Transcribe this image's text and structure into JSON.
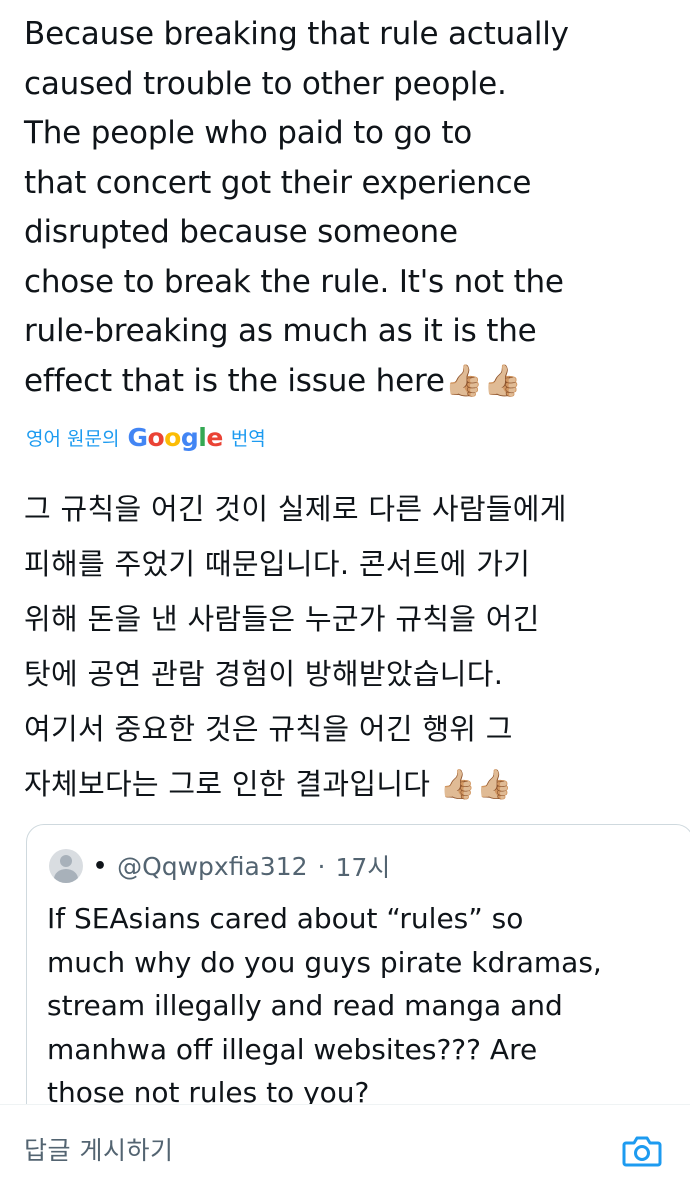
{
  "post": {
    "text_lines": [
      "Because breaking that rule actually",
      "caused trouble to other people.",
      "The people who paid to go to",
      "that concert got their experience",
      "disrupted because someone",
      "chose to break the rule. It's not the",
      "rule-breaking as much as it is the",
      "effect that is the issue here👍🏼👍🏼"
    ],
    "translation": {
      "prefix": "영어 원문의",
      "google": "Google",
      "suffix": "번역"
    },
    "translated_lines": [
      "그 규칙을 어긴 것이 실제로 다른 사람들에게",
      "피해를 주었기 때문입니다. 콘서트에 가기",
      "위해 돈을 낸 사람들은 누군가 규칙을 어긴",
      "탓에 공연 관람 경험이 방해받았습니다.",
      "여기서 중요한 것은 규칙을 어긴 행위 그",
      "자체보다는 그로 인한 결과입니다 👍🏼👍🏼"
    ]
  },
  "quote": {
    "dot": "•",
    "handle": "@Qqwpxfia312",
    "separator": "·",
    "time": "17시",
    "text_lines": [
      "If SEAsians cared about “rules” so",
      "much why do you guys pirate kdramas,",
      "stream illegally and read manga and",
      "manhwa off illegal websites??? Are",
      "those not rules to you?"
    ]
  },
  "reply": {
    "placeholder": "답글 게시하기",
    "icon": "camera-icon",
    "accent": "#1d9bf0"
  },
  "colors": {
    "link": "#1d9bf0",
    "text": "#0f1419",
    "secondary": "#536471",
    "google_blue": "#4285F4",
    "google_red": "#EA4335",
    "google_yellow": "#FBBC05",
    "google_green": "#34A853"
  }
}
